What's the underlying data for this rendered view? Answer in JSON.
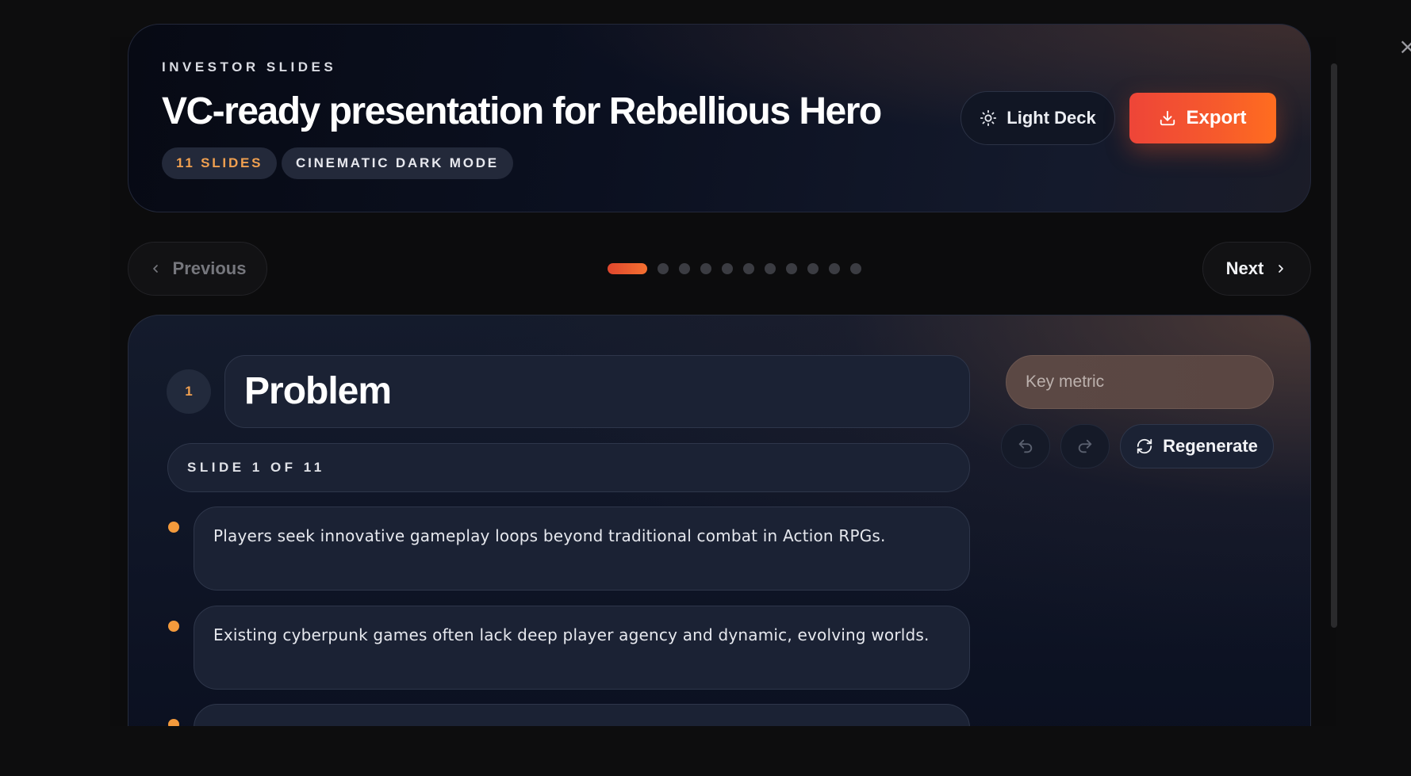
{
  "header": {
    "eyebrow": "INVESTOR SLIDES",
    "title": "VC-ready presentation for Rebellious Hero",
    "chips": [
      "11 SLIDES",
      "CINEMATIC DARK MODE"
    ],
    "theme_button": "Light Deck",
    "export_button": "Export"
  },
  "nav": {
    "previous": "Previous",
    "next": "Next",
    "total_slides": 11,
    "current_slide": 1
  },
  "slide": {
    "number": "1",
    "title": "Problem",
    "subtitle": "SLIDE 1 OF 11",
    "bullets": [
      "Players seek innovative gameplay loops beyond traditional combat in Action RPGs.",
      "Existing cyberpunk games often lack deep player agency and dynamic, evolving worlds.",
      ""
    ],
    "metric_placeholder": "Key metric",
    "regenerate_button": "Regenerate"
  },
  "colors": {
    "accent": "#f65a2c",
    "bullet": "#f39a3c",
    "card_bg": "#0f1526"
  },
  "icons": [
    "close-icon",
    "sun-icon",
    "download-icon",
    "chevron-left-icon",
    "chevron-right-icon",
    "undo-icon",
    "redo-icon",
    "refresh-icon"
  ]
}
